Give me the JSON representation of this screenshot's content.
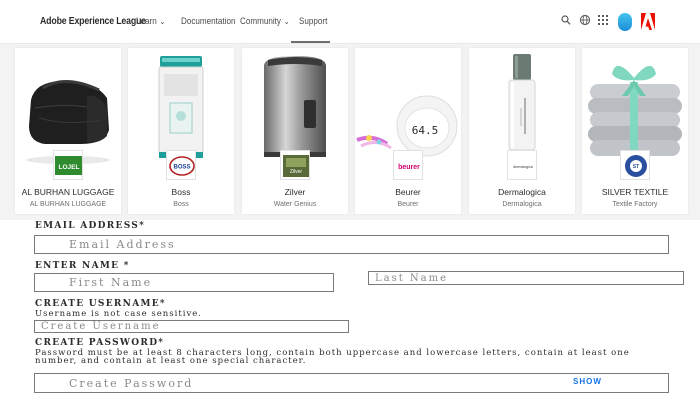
{
  "header": {
    "brand": "Adobe Experience League",
    "nav": [
      {
        "label": "Learn",
        "has_dropdown": true
      },
      {
        "label": "Documentation",
        "has_dropdown": false
      },
      {
        "label": "Community",
        "has_dropdown": true
      },
      {
        "label": "Support",
        "has_dropdown": false,
        "active": true
      }
    ],
    "icons": [
      "search-icon",
      "globe-icon",
      "apps-grid-icon",
      "user-avatar",
      "adobe-logo"
    ]
  },
  "cards": [
    {
      "title": "AL BURHAN LUGGAGE",
      "subtitle": "AL BURHAN LUGGAGE",
      "logo_text": "LOJEL",
      "product": "black travel bag"
    },
    {
      "title": "Boss",
      "subtitle": "Boss",
      "logo_text": "BOSS",
      "product": "washing machine"
    },
    {
      "title": "Zilver",
      "subtitle": "Water Genius",
      "logo_text": "Zilver",
      "product": "steel water dispenser"
    },
    {
      "title": "Beurer",
      "subtitle": "Beurer",
      "logo_text": "beurer",
      "product": "bathroom scale",
      "scale_readout": "64.5"
    },
    {
      "title": "Dermalogica",
      "subtitle": "Dermalogica",
      "logo_text": "dermalogica",
      "product": "serum bottle"
    },
    {
      "title": "SILVER TEXTILE",
      "subtitle": "Textile Factory",
      "logo_text": "ST",
      "product": "towel stack with ribbon"
    }
  ],
  "form": {
    "email": {
      "label": "EMAIL ADDRESS*",
      "placeholder": "Email Address",
      "value": ""
    },
    "name": {
      "label": "ENTER NAME *",
      "first_placeholder": "First Name",
      "last_placeholder": "Last Name"
    },
    "username": {
      "label": "CREATE USERNAME*",
      "help": "Username is not case sensitive.",
      "placeholder": "Create Username"
    },
    "password": {
      "label": "CREATE PASSWORD*",
      "help": "Password must be at least 8 characters long, contain both uppercase and lowercase letters, contain at least one number, and contain at least one special character.",
      "placeholder": "Create Password",
      "show_label": "SHOW"
    }
  },
  "colors": {
    "link": "#1473e6",
    "adobe_red": "#eb1000",
    "lojel_green": "#2e8b2e",
    "ribbon": "#7fd8bf"
  }
}
